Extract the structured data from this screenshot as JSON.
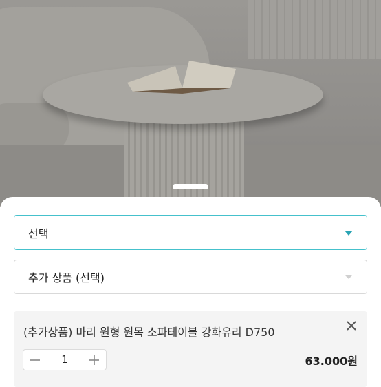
{
  "photo": {
    "alt": "round coffee table with open book"
  },
  "options": {
    "primary": {
      "label": "선택",
      "icon": "chevron-down-icon",
      "accent": "#45c1cc"
    },
    "secondary": {
      "label": "추가 상품 (선택)",
      "icon": "chevron-down-icon"
    }
  },
  "selected_item": {
    "name": "(추가상품) 마리 원형 원목 소파테이블 강화유리 D750",
    "quantity": "1",
    "price": "63.000원",
    "remove_icon": "close-icon",
    "decrease_icon": "minus-icon",
    "increase_icon": "plus-icon"
  }
}
